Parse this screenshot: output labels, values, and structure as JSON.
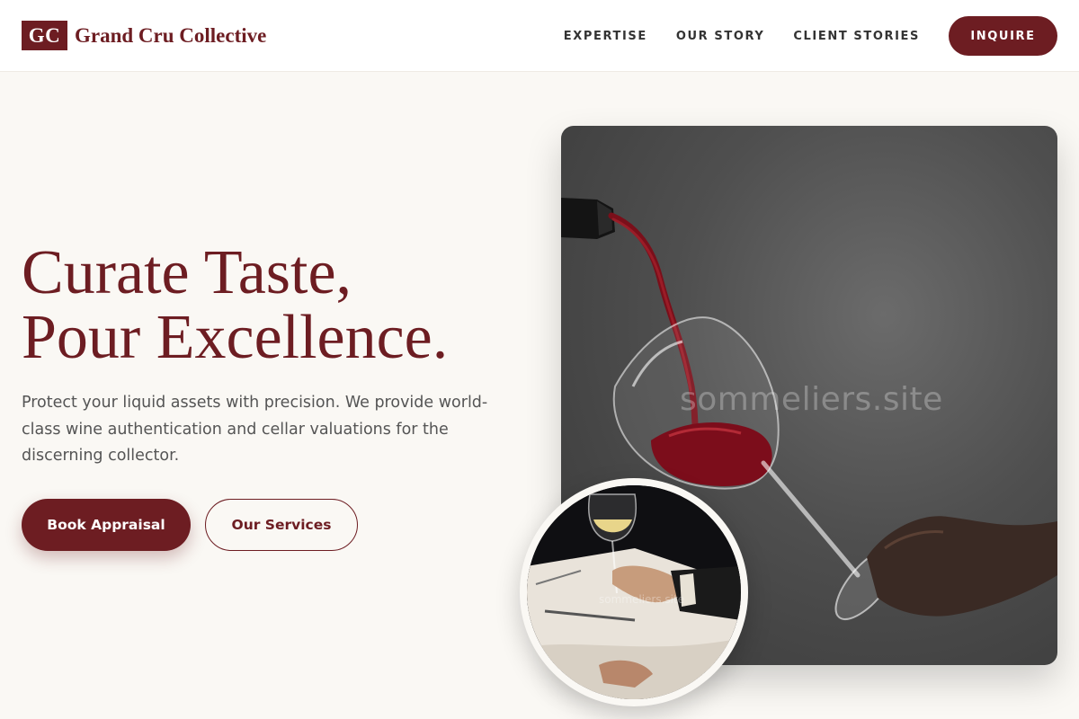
{
  "brand": {
    "mark": "GC",
    "name": "Grand Cru Collective",
    "color": "#6d1d22"
  },
  "nav": {
    "items": [
      "EXPERTISE",
      "OUR STORY",
      "CLIENT STORIES"
    ],
    "cta": "INQUIRE"
  },
  "hero": {
    "title_line1": "Curate Taste,",
    "title_line2": "Pour Excellence.",
    "subtitle": "Protect your liquid assets with precision. We provide world-class wine authentication and cellar valuations for the discerning collector.",
    "primary_button": "Book Appraisal",
    "secondary_button": "Our Services"
  },
  "images": {
    "main": {
      "icon": "red-wine-pour-photo",
      "watermark": "sommeliers.site"
    },
    "inset": {
      "icon": "white-wine-dining-photo",
      "watermark": "sommeliers.site"
    }
  },
  "colors": {
    "accent": "#6d1d22",
    "background": "#faf8f4",
    "header": "#ffffff",
    "text": "#555555"
  }
}
